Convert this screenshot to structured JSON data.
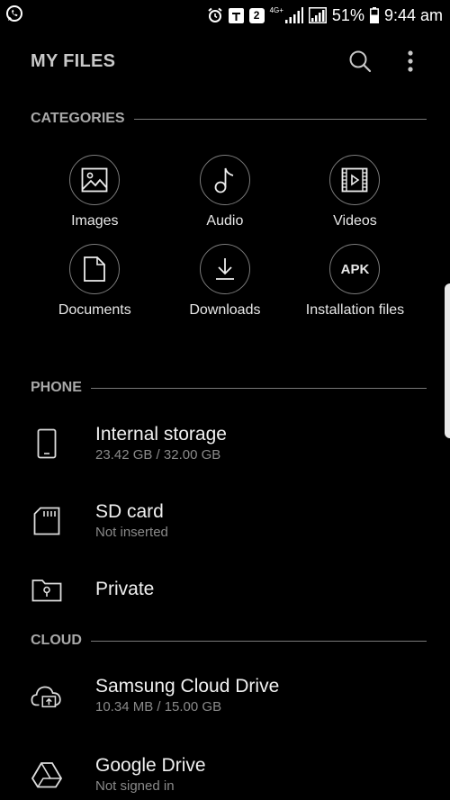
{
  "status_bar": {
    "network_label": "4G+",
    "badge_number": "2",
    "battery": "51%",
    "time": "9:44 am"
  },
  "app_bar": {
    "title": "MY FILES"
  },
  "categories": {
    "header": "CATEGORIES",
    "items": [
      {
        "label": "Images",
        "icon": "image-icon"
      },
      {
        "label": "Audio",
        "icon": "music-note-icon"
      },
      {
        "label": "Videos",
        "icon": "video-icon"
      },
      {
        "label": "Documents",
        "icon": "document-icon"
      },
      {
        "label": "Downloads",
        "icon": "download-icon"
      },
      {
        "label": "Installation files",
        "icon": "apk-icon",
        "icon_text": "APK"
      }
    ]
  },
  "phone": {
    "header": "PHONE",
    "items": [
      {
        "title": "Internal storage",
        "subtitle": "23.42 GB / 32.00 GB",
        "icon": "phone-icon"
      },
      {
        "title": "SD card",
        "subtitle": "Not inserted",
        "icon": "sd-card-icon"
      },
      {
        "title": "Private",
        "subtitle": "",
        "icon": "private-folder-icon"
      }
    ]
  },
  "cloud": {
    "header": "CLOUD",
    "items": [
      {
        "title": "Samsung Cloud Drive",
        "subtitle": "10.34 MB / 15.00 GB",
        "icon": "cloud-icon"
      },
      {
        "title": "Google Drive",
        "subtitle": "Not signed in",
        "icon": "google-drive-icon"
      }
    ]
  },
  "colors": {
    "background": "#000000",
    "text": "#ffffff",
    "muted": "#8a8a8a",
    "divider": "#7a7a7a"
  }
}
